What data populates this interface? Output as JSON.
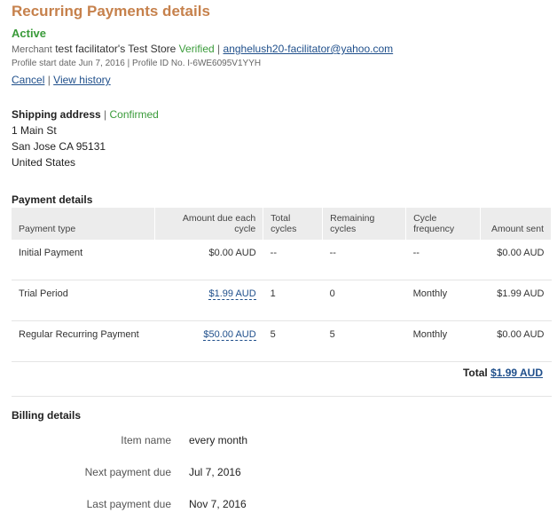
{
  "page": {
    "title": "Recurring Payments details",
    "status": "Active"
  },
  "merchant": {
    "label": "Merchant",
    "name": "test facilitator's Test Store",
    "verified": "Verified",
    "separator": "|",
    "email": "anghelush20-facilitator@yahoo.com"
  },
  "profile": {
    "start_date_text": "Profile start date Jun 7, 2016",
    "separator": "|",
    "profile_id_text": "Profile ID No. I-6WE6095V1YYH"
  },
  "actions": {
    "cancel": "Cancel",
    "separator": "|",
    "view_history": "View history"
  },
  "shipping": {
    "heading": "Shipping address",
    "separator": "|",
    "status": "Confirmed",
    "lines": [
      "1 Main St",
      "San Jose CA 95131",
      "United States"
    ]
  },
  "payment_details": {
    "heading": "Payment details",
    "columns": [
      "Payment type",
      "Amount due each cycle",
      "Total cycles",
      "Remaining cycles",
      "Cycle frequency",
      "Amount sent"
    ],
    "rows": [
      {
        "type": "Initial Payment",
        "amount": "$0.00 AUD",
        "total": "--",
        "remaining": "--",
        "frequency": "--",
        "sent": "$0.00 AUD"
      },
      {
        "type": "Trial Period",
        "amount": "$1.99 AUD",
        "total": "1",
        "remaining": "0",
        "frequency": "Monthly",
        "sent": "$1.99 AUD"
      },
      {
        "type": "Regular Recurring Payment",
        "amount": "$50.00 AUD",
        "total": "5",
        "remaining": "5",
        "frequency": "Monthly",
        "sent": "$0.00 AUD"
      }
    ],
    "total_label": "Total",
    "total_value": "$1.99 AUD"
  },
  "billing": {
    "heading": "Billing details",
    "item_name_label": "Item name",
    "item_name_value": "every month",
    "next_due_label": "Next payment due",
    "next_due_value": "Jul 7, 2016",
    "last_due_label": "Last payment due",
    "last_due_value": "Nov 7, 2016"
  },
  "colors": {
    "title": "#c6814c",
    "status_green": "#3a9b3a",
    "link": "#1f4f8b",
    "header_bg": "#ececec"
  }
}
